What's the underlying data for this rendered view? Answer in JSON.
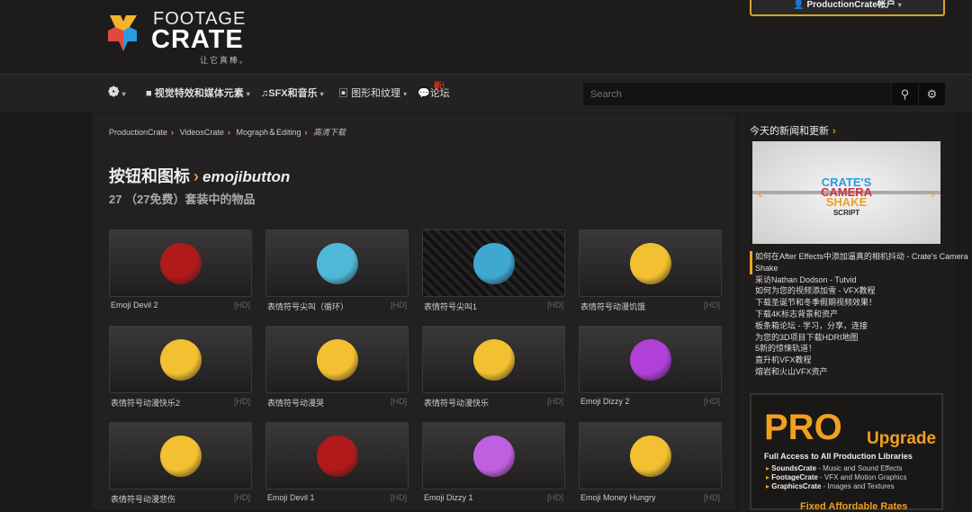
{
  "header": {
    "logo_top": "FOOTAGE",
    "logo_bottom": "CRATE",
    "tagline": "让它真棒。",
    "account_label": "ProductionCrate帐户"
  },
  "nav": {
    "items": [
      {
        "label": "视觉特效和媒体元素"
      },
      {
        "label": "SFX和音乐"
      },
      {
        "label": "图形和纹理"
      },
      {
        "label": "论坛"
      }
    ],
    "new_badge": "新!",
    "search_placeholder": "Search"
  },
  "breadcrumb": [
    "ProductionCrate",
    "VideosCrate",
    "Mograph＆Editing",
    "高清下载"
  ],
  "page": {
    "category": "按钮和图标",
    "title": "emojibutton",
    "subtitle": "27 （27免费）套装中的物品"
  },
  "items": [
    {
      "name": "Emoji Devil 2",
      "badge": "[HD]",
      "face_color": "#b01a1a"
    },
    {
      "name": "表情符号尖叫（循环）",
      "badge": "[HD]",
      "face_color": "#4fb8d8"
    },
    {
      "name": "表情符号尖叫1",
      "badge": "[HD]",
      "face_color": "#3fa8d0"
    },
    {
      "name": "表情符号动漫饥饿",
      "badge": "[HD]",
      "face_color": "#f2c030"
    },
    {
      "name": "表情符号动漫快乐2",
      "badge": "[HD]",
      "face_color": "#f2c030"
    },
    {
      "name": "表情符号动漫哭",
      "badge": "[HD]",
      "face_color": "#f2c030"
    },
    {
      "name": "表情符号动漫快乐",
      "badge": "[HD]",
      "face_color": "#f2c030"
    },
    {
      "name": "Emoji Dizzy 2",
      "badge": "[HD]",
      "face_color": "#b040d8"
    },
    {
      "name": "表情符号动漫悲伤",
      "badge": "[HD]",
      "face_color": "#f2c030"
    },
    {
      "name": "Emoji Devil 1",
      "badge": "[HD]",
      "face_color": "#b01a1a"
    },
    {
      "name": "Emoji Dizzy 1",
      "badge": "[HD]",
      "face_color": "#c060e0"
    },
    {
      "name": "Emoji Money Hungry",
      "badge": "[HD]",
      "face_color": "#f2c030"
    }
  ],
  "sidebar": {
    "heading": "今天的新闻和更新",
    "banner": {
      "l1": "CRATE'S",
      "l2": "CAMERA",
      "l3": "SHAKE",
      "l4": "SCRIPT"
    },
    "news": [
      "如何在After Effects中添加逼真的相机抖动 - Crate's Camera Shake",
      "采访Nathan Dodson - Tutvid",
      "如何为您的视频添加雪 - VFX教程",
      "下载圣诞节和冬季假期视频效果！",
      "下载4K标志背景和资产",
      "板条箱论坛 - 学习，分享，连接",
      "为您的3D项目下载HDRI地图",
      "5新的惊悚轨道！",
      "直升机VFX教程",
      "熔岩和火山VFX资产"
    ],
    "pro": {
      "big": "PRO",
      "upgrade": "Upgrade",
      "line": "Full Access to All Production Libraries",
      "features": [
        {
          "name": "SoundsCrate",
          "desc": "- Music and Sound Effects"
        },
        {
          "name": "FootageCrate",
          "desc": "- VFX and Motion Graphics"
        },
        {
          "name": "GraphicsCrate",
          "desc": "- Images and Textures"
        }
      ],
      "rates": "Fixed Affordable Rates"
    }
  }
}
